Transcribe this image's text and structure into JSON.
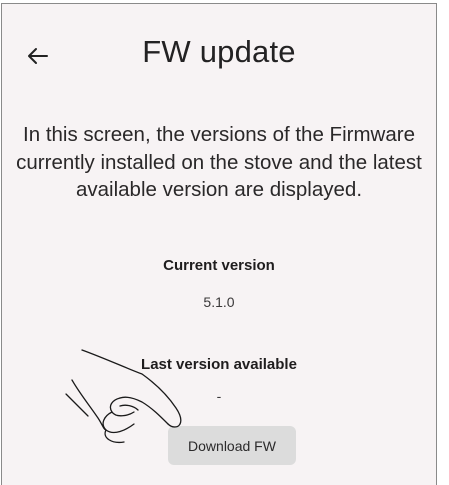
{
  "header": {
    "back_icon": "arrow-left-icon",
    "title": "FW update"
  },
  "description": "In this screen, the versions of the Firmware currently installed on the stove and the latest available version are displayed.",
  "current": {
    "label": "Current version",
    "value": "5.1.0"
  },
  "latest": {
    "label": "Last version available",
    "value": "-"
  },
  "actions": {
    "download_label": "Download FW"
  },
  "overlay": {
    "icon": "pointing-hand-icon"
  },
  "colors": {
    "background": "#f7f3f4",
    "button": "#dcdcdc",
    "text": "#1d1b1c"
  }
}
